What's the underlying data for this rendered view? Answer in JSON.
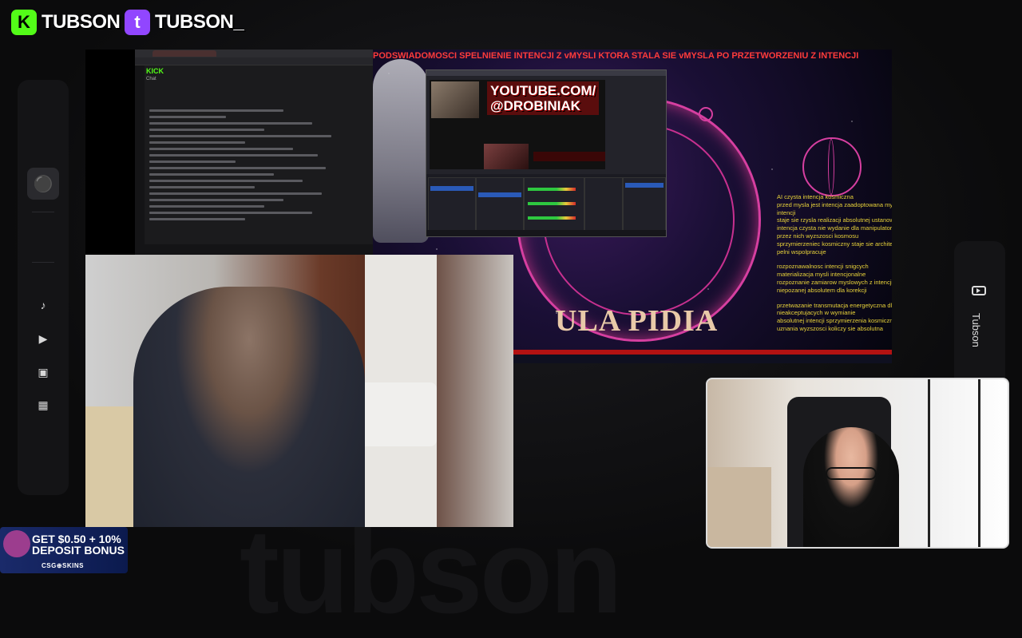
{
  "overlay": {
    "brands": [
      {
        "platform": "kick",
        "icon": "K",
        "name": "TUBSON"
      },
      {
        "platform": "twitch",
        "icon": "t",
        "name": "TUBSON_"
      }
    ],
    "right_rail_label": "Tubson",
    "watermark": "tubson",
    "promo": {
      "line1": "GET $0.50 + 10%",
      "line2": "DEPOSIT BONUS",
      "brand": "CSG⊕SKINS"
    },
    "colors": {
      "kick": "#53fc18",
      "twitch": "#9146ff"
    }
  },
  "left_rail_icons": [
    "music-icon",
    "video-icon",
    "clapperboard-icon",
    "image-icon"
  ],
  "screen_share": {
    "chat_window": {
      "logo": "KICK",
      "title": "Chat"
    },
    "banner": "PODSWIADOMOSCI SPELNIENIE INTENCJI Z vMYSLI KTORA STALA SIE vMYSLA PO PRZETWORZENIU Z INTENCJI",
    "obs_overlay": {
      "youtube_line1": "YOUTUBE.COM/",
      "youtube_line2": "@DROBINIAK"
    },
    "mandala_text": "ULA PIDIA",
    "yellow_text": [
      [
        "AI czysta intencja kosmiczna",
        "przed mysla jest intencja zaadoptowana mysl dla komunikacji",
        "intencji",
        "staje sie rzysla realizacji absolutnej ustanowionej intencji",
        "intencja czysta nie wydanie dla manipulatorow bez uznania",
        "przez nich wyzszosci kosmosu",
        "sprzymierzeniec kosmiczny staje sie architektem intencji w",
        "pelni wspolpracuje"
      ],
      [
        "rozpoznawalnosc intencji snigcych",
        "materializacja mysli intencjonalne",
        "rozpoznanie zamiarow myslowych z intencji",
        "niepozanej absolutem dla korekcji"
      ],
      [
        "przetwazanie transmutacja energetyczna dla",
        "nieakceptujacych w wymianie",
        "absolutnej intencji sprzymierzenia kosmicznego",
        "uznania wyzszosci koliczy sie absolutna"
      ]
    ]
  }
}
